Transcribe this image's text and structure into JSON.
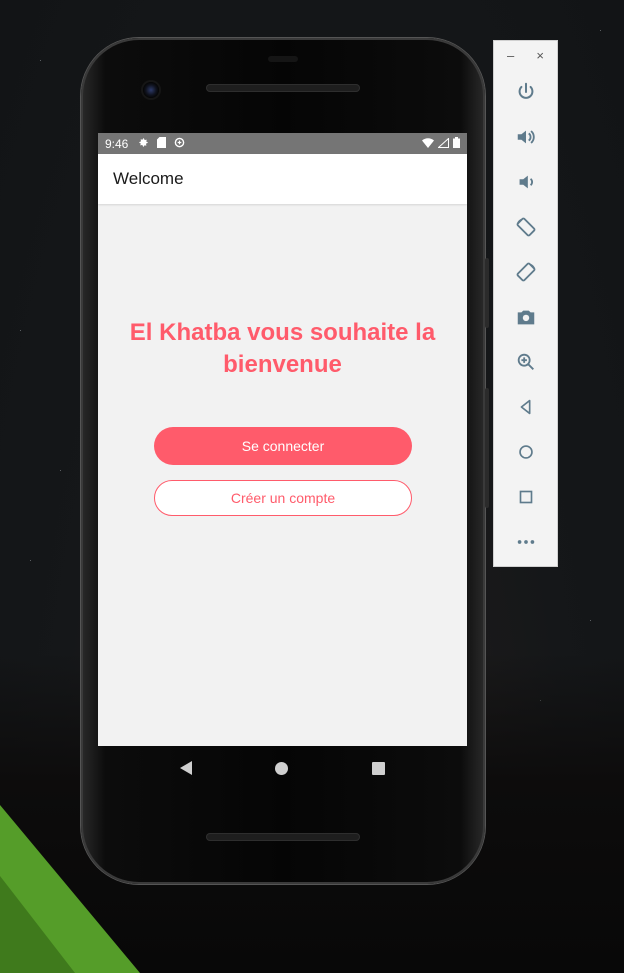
{
  "status_bar": {
    "time": "9:46"
  },
  "app_bar": {
    "title": "Welcome"
  },
  "main": {
    "welcome_message": "El Khatba vous souhaite la bienvenue",
    "login_button": "Se connecter",
    "signup_button": "Créer un compte"
  },
  "emulator_toolbar": {
    "minimize": "–",
    "close": "×",
    "items": [
      "power-icon",
      "volume-up-icon",
      "volume-down-icon",
      "rotate-left-icon",
      "rotate-right-icon",
      "camera-icon",
      "zoom-icon",
      "back-icon",
      "home-icon",
      "overview-icon",
      "more-icon"
    ]
  },
  "colors": {
    "accent": "#ff5b6b",
    "status_bar": "#757575",
    "screen_bg": "#f2f2f2",
    "toolbar_icon": "#5f7b8c"
  }
}
